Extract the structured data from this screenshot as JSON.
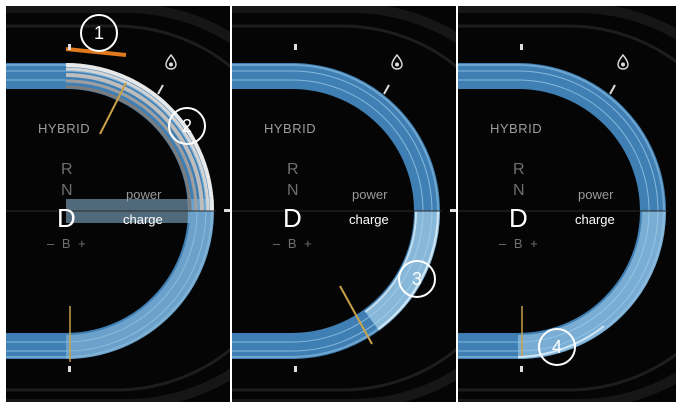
{
  "panels": [
    {
      "mode": "HYBRID",
      "gears": [
        "R",
        "N",
        "D"
      ],
      "selected_gear": "D",
      "b_mark": "– B +",
      "power_label": "power",
      "charge_label": "charge",
      "callouts": [
        "1",
        "2"
      ]
    },
    {
      "mode": "HYBRID",
      "gears": [
        "R",
        "N",
        "D"
      ],
      "selected_gear": "D",
      "b_mark": "– B +",
      "power_label": "power",
      "charge_label": "charge",
      "callouts": [
        "3"
      ]
    },
    {
      "mode": "HYBRID",
      "gears": [
        "R",
        "N",
        "D"
      ],
      "selected_gear": "D",
      "b_mark": "– B +",
      "power_label": "power",
      "charge_label": "charge",
      "callouts": [
        "4"
      ]
    }
  ],
  "icons": [
    "fuel-drop-icon"
  ],
  "colors": {
    "gauge_blue": "#3f7fb3",
    "indicator_amber": "#c9a24a",
    "orange_bar": "#e07a1c",
    "background": "#050505"
  }
}
